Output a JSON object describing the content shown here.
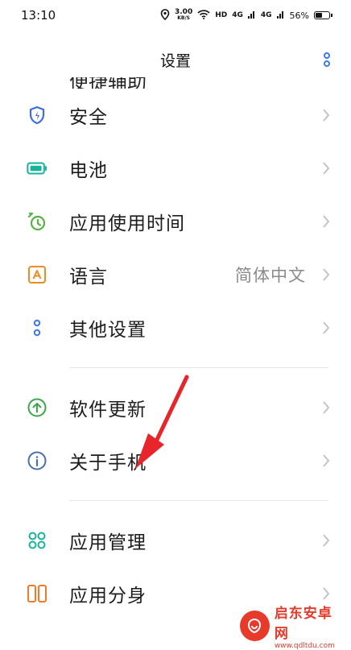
{
  "status_bar": {
    "time": "13:10",
    "speed_value": "3.00",
    "speed_unit": "KB/S",
    "hd_label": "HD",
    "net_1": "4G",
    "net_2": "4G",
    "battery_percent": "56%",
    "battery_level": 0.56
  },
  "header": {
    "title": "设置"
  },
  "partial_row": {
    "label": "便捷辅助"
  },
  "settings": [
    {
      "label": "安全",
      "icon": "shield-icon",
      "color": "#3b6fe0"
    },
    {
      "label": "电池",
      "icon": "battery-icon",
      "color": "#19b39a"
    },
    {
      "label": "应用使用时间",
      "icon": "alarm-clock-icon",
      "color": "#58b046"
    },
    {
      "label": "语言",
      "value": "简体中文",
      "icon": "language-icon",
      "color": "#f08a24"
    },
    {
      "label": "其他设置",
      "icon": "more-settings-icon",
      "color": "#3d7be0"
    },
    {
      "label": "软件更新",
      "icon": "update-icon",
      "color": "#3aa84a"
    },
    {
      "label": "关于手机",
      "icon": "info-icon",
      "color": "#4a6fb0"
    },
    {
      "label": "应用管理",
      "icon": "app-grid-icon",
      "color": "#19b39a"
    },
    {
      "label": "应用分身",
      "icon": "app-clone-icon",
      "color": "#f07a28"
    }
  ],
  "watermark": {
    "name": "启东安卓网",
    "url": "www.qdltdu.com"
  },
  "colors": {
    "arrow": "#e8252a",
    "chevron": "#c4c4c4",
    "divider": "#e6e6e6"
  }
}
